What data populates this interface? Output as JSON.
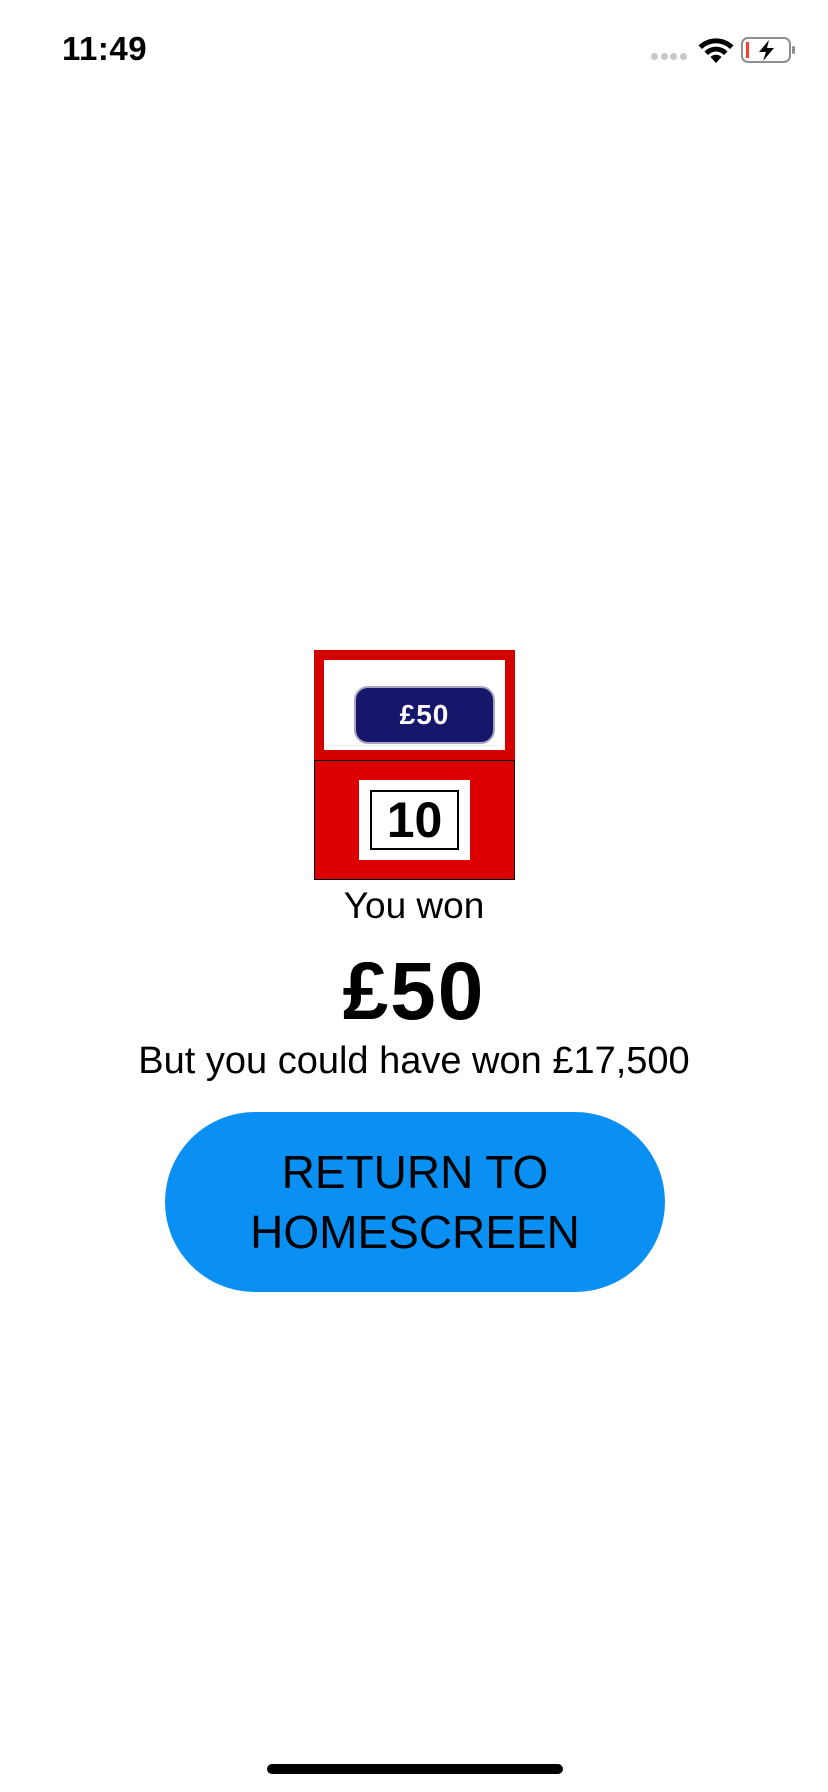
{
  "status_bar": {
    "time": "11:49",
    "icons": [
      "signal-icon",
      "wifi-icon",
      "battery-charging-icon"
    ]
  },
  "case": {
    "amount": "£50",
    "number": "10"
  },
  "result": {
    "you_won_label": "You won",
    "won_amount": "£50",
    "could_have_text": "But you could have won £17,500"
  },
  "return_button": {
    "line1": "RETURN TO",
    "line2": "HOMESCREEN"
  },
  "colors": {
    "case_red": "#d40000",
    "pill_navy": "#16166a",
    "button_blue": "#0a8ff2",
    "battery_low_red": "#ff3b30"
  }
}
